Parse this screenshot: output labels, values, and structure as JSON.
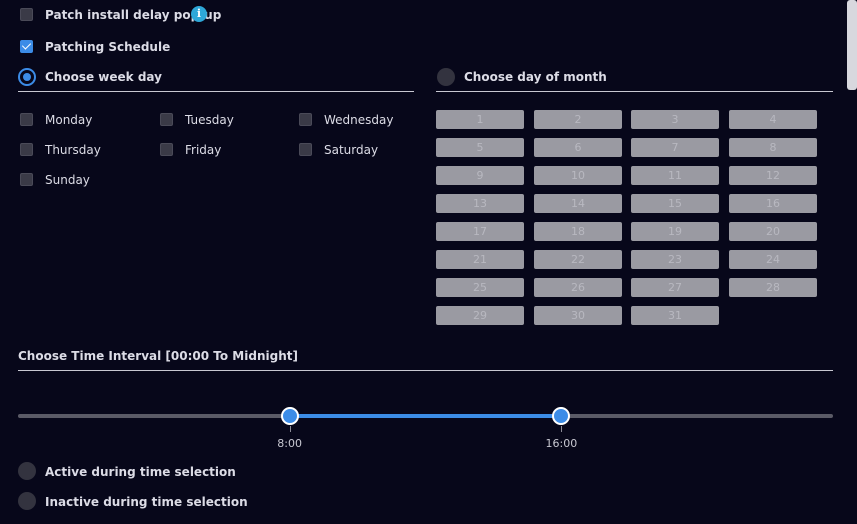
{
  "patch_delay": {
    "label": "Patch install delay pop-up",
    "checked": false,
    "info_icon": "i"
  },
  "patching_schedule": {
    "label": "Patching Schedule",
    "checked": true
  },
  "week_mode": {
    "label": "Choose week day",
    "selected": true
  },
  "month_mode": {
    "label": "Choose day of month",
    "selected": false
  },
  "weekdays": [
    "Monday",
    "Tuesday",
    "Wednesday",
    "Thursday",
    "Friday",
    "Saturday",
    "Sunday"
  ],
  "month_days": [
    "1",
    "2",
    "3",
    "4",
    "5",
    "6",
    "7",
    "8",
    "9",
    "10",
    "11",
    "12",
    "13",
    "14",
    "15",
    "16",
    "17",
    "18",
    "19",
    "20",
    "21",
    "22",
    "23",
    "24",
    "25",
    "26",
    "27",
    "28",
    "29",
    "30",
    "31"
  ],
  "time_interval": {
    "label": "Choose Time Interval [00:00 To Midnight]",
    "start_label": "8:00",
    "end_label": "16:00",
    "start_fraction": 0.3333,
    "end_fraction": 0.6667
  },
  "active_option": {
    "label": "Active during time selection",
    "selected": false
  },
  "inactive_option": {
    "label": "Inactive during time selection",
    "selected": false
  },
  "colors": {
    "accent": "#3c8ce7",
    "background": "#07071a",
    "info": "#2ea7d8"
  }
}
